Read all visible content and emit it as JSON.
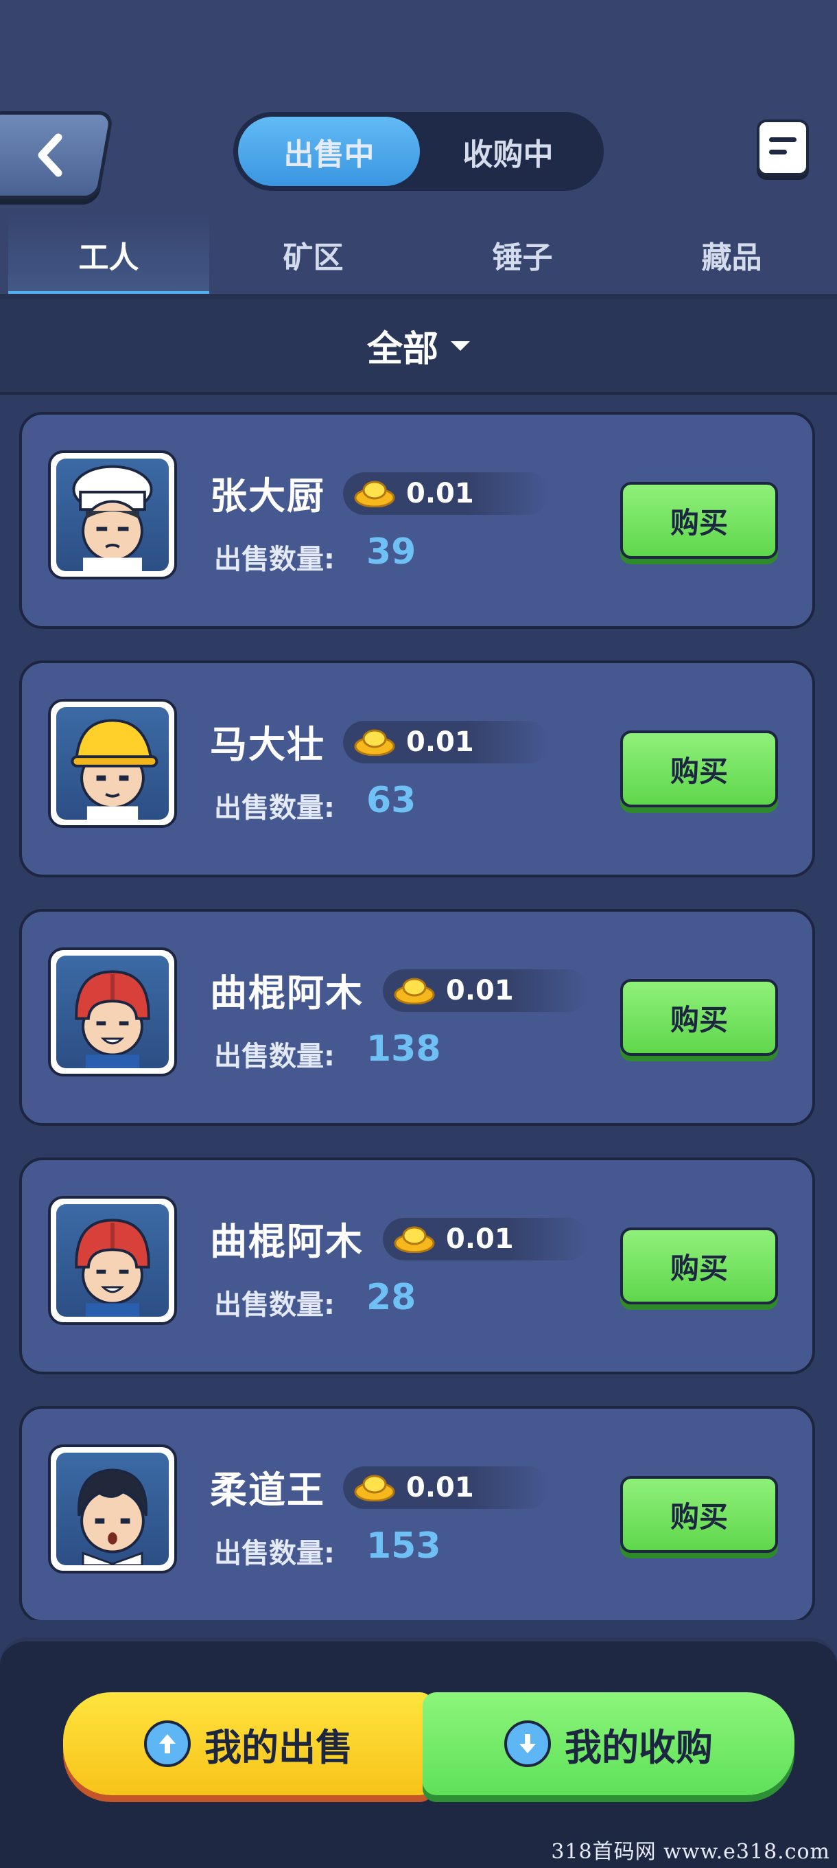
{
  "header": {
    "segments": [
      "出售中",
      "收购中"
    ],
    "active_segment": "出售中"
  },
  "tabs": [
    "工人",
    "矿区",
    "锤子",
    "藏品"
  ],
  "active_tab": "工人",
  "filter": {
    "label": "全部"
  },
  "listings": [
    {
      "name": "张大厨",
      "price": "0.01",
      "qty_label": "出售数量:",
      "qty": "39",
      "buy_label": "购买",
      "avatar": "chef-avatar"
    },
    {
      "name": "马大壮",
      "price": "0.01",
      "qty_label": "出售数量:",
      "qty": "63",
      "buy_label": "购买",
      "avatar": "hardhat-worker-avatar"
    },
    {
      "name": "曲棍阿木",
      "price": "0.01",
      "qty_label": "出售数量:",
      "qty": "138",
      "buy_label": "购买",
      "avatar": "hockey-player-avatar"
    },
    {
      "name": "曲棍阿木",
      "price": "0.01",
      "qty_label": "出售数量:",
      "qty": "28",
      "buy_label": "购买",
      "avatar": "hockey-player-avatar"
    },
    {
      "name": "柔道王",
      "price": "0.01",
      "qty_label": "出售数量:",
      "qty": "153",
      "buy_label": "购买",
      "avatar": "judo-fighter-avatar"
    }
  ],
  "bottom": {
    "my_sales": "我的出售",
    "my_purchases": "我的收购"
  },
  "watermark": "318首码网 www.e318.com",
  "colors": {
    "accent_blue": "#4fb1f2",
    "buy_green": "#6fe35c",
    "sell_yellow": "#ffd42a",
    "qty_blue": "#6fc0f5"
  }
}
